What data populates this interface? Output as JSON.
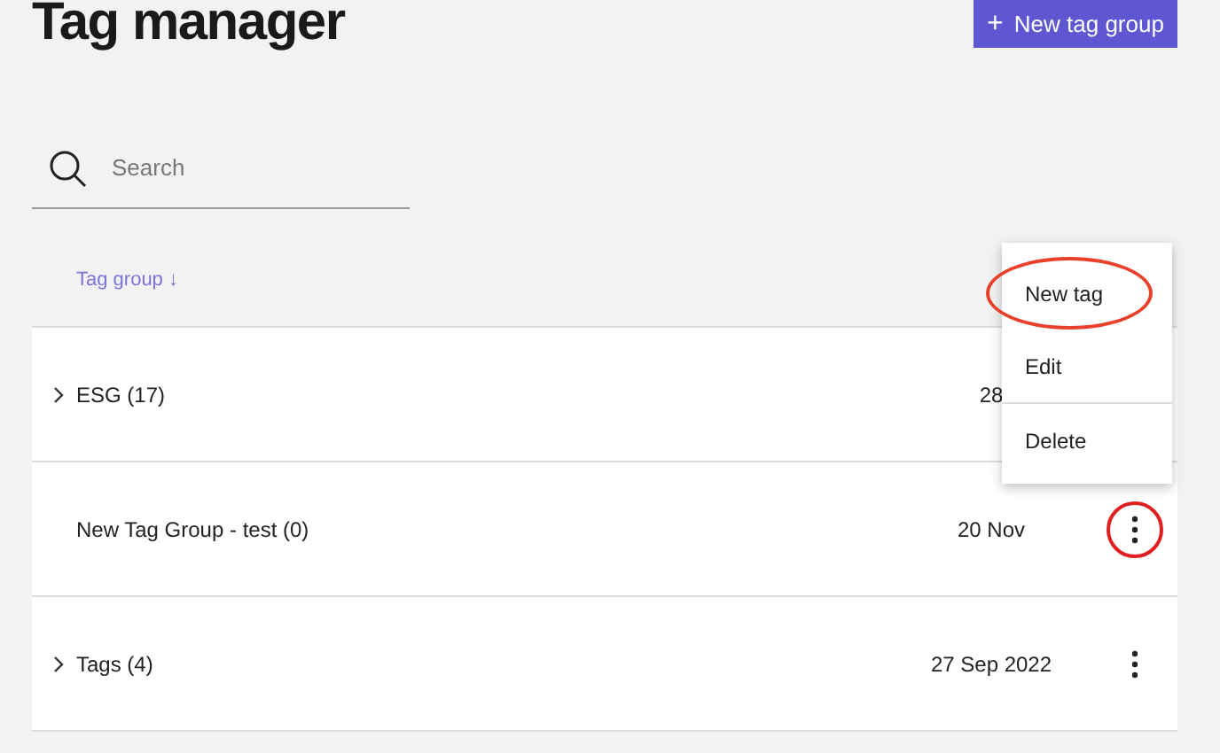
{
  "title": "Tag manager",
  "new_button": {
    "icon": "+",
    "label": "New tag group"
  },
  "search": {
    "placeholder": "Search"
  },
  "table": {
    "columns": [
      {
        "label": "Tag group ↓"
      }
    ],
    "rows": [
      {
        "name": "ESG (17)",
        "expandable": true,
        "date": "28",
        "menu_visible": false,
        "circled": false
      },
      {
        "name": "New Tag Group - test (0)",
        "expandable": false,
        "date": "20 Nov",
        "menu_visible": true,
        "circled": true
      },
      {
        "name": "Tags (4)",
        "expandable": true,
        "date": "27 Sep 2022",
        "menu_visible": true,
        "circled": false
      }
    ]
  },
  "context_menu": {
    "items": [
      {
        "label": "New tag",
        "circled": true,
        "divider_before": false
      },
      {
        "label": "Edit",
        "circled": false,
        "divider_before": false
      },
      {
        "label": "Delete",
        "circled": false,
        "divider_before": true
      }
    ]
  }
}
